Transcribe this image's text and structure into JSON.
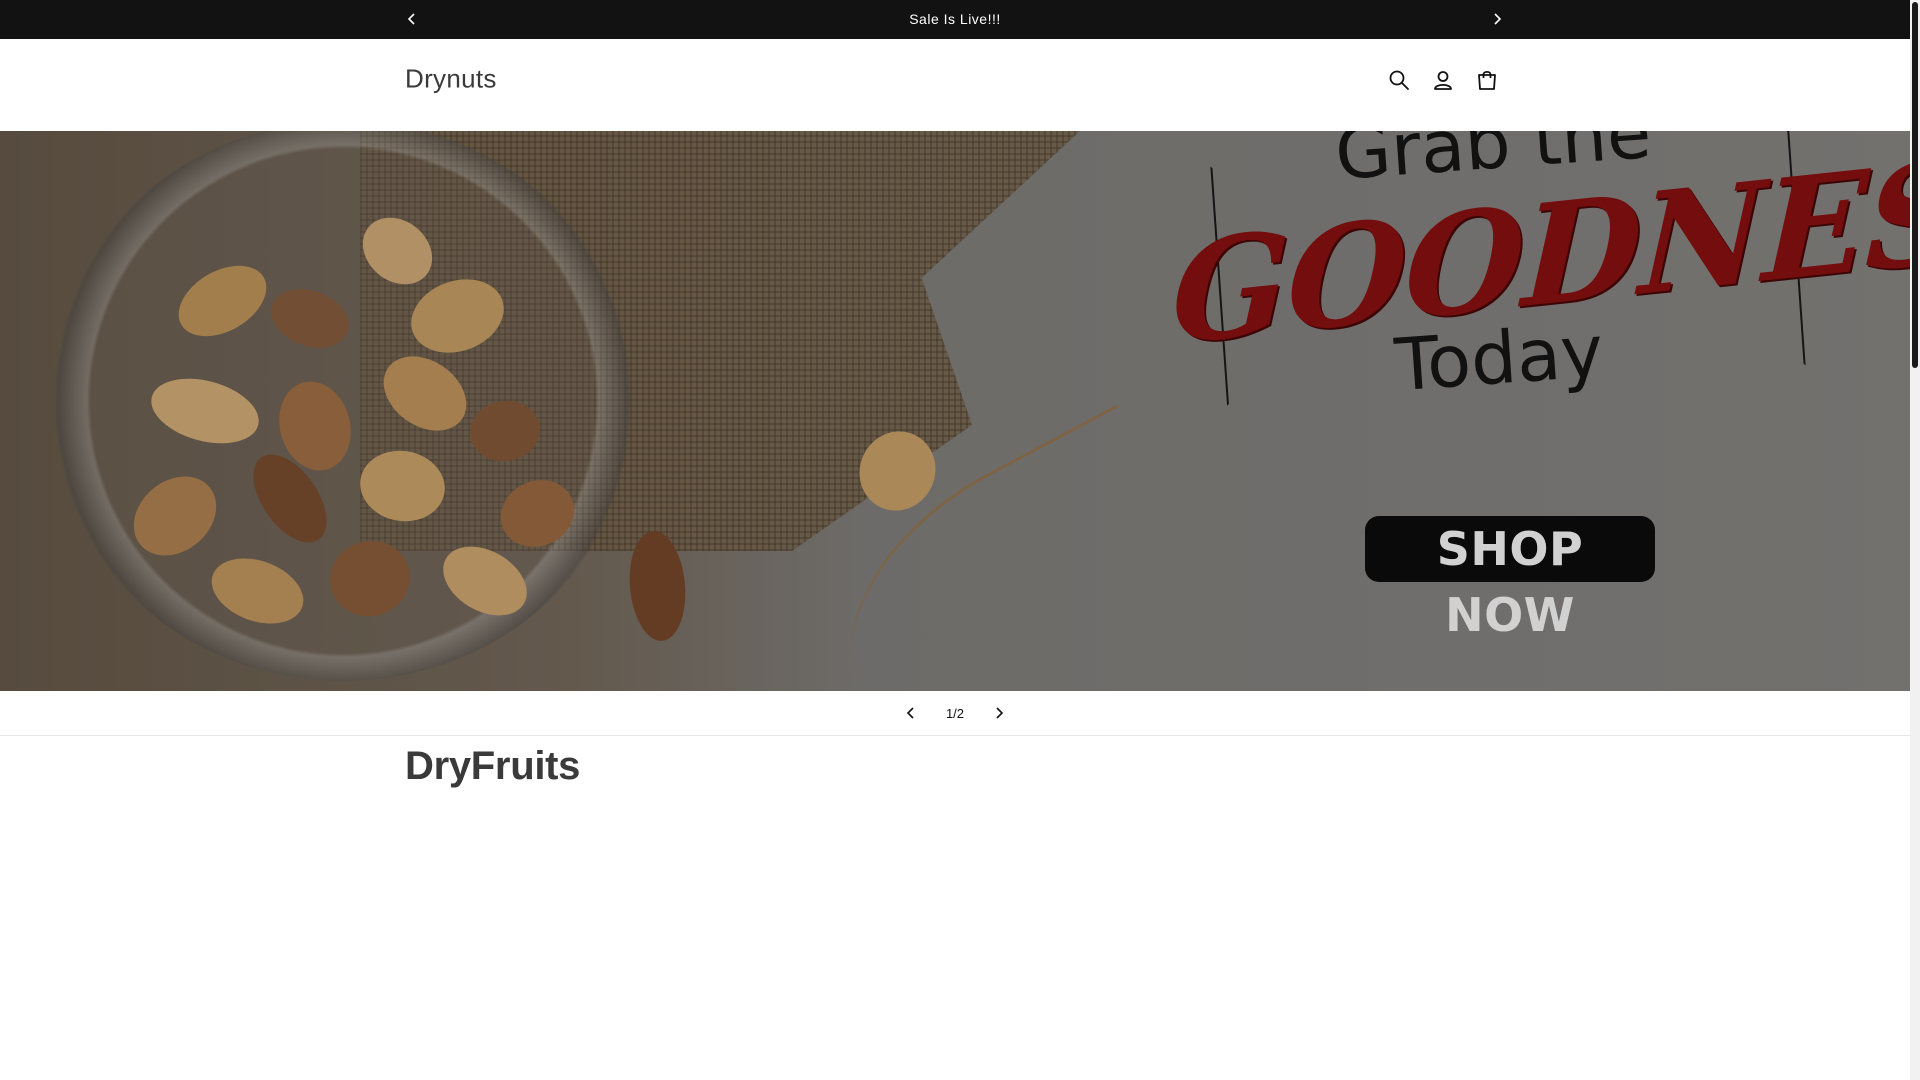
{
  "announcement": {
    "text": "Sale Is Live!!!",
    "prev_icon": "chevron-left-icon",
    "next_icon": "chevron-right-icon"
  },
  "header": {
    "logo": "Drynuts",
    "icons": [
      "search-icon",
      "account-icon",
      "cart-icon"
    ]
  },
  "hero": {
    "line1": "Grab the",
    "line2": "GOODNESS",
    "line3": "Today",
    "cta": "SHOP NOW",
    "accent_color": "#8e1010"
  },
  "slider": {
    "counter": "1/2"
  },
  "section": {
    "title": "DryFruits"
  }
}
